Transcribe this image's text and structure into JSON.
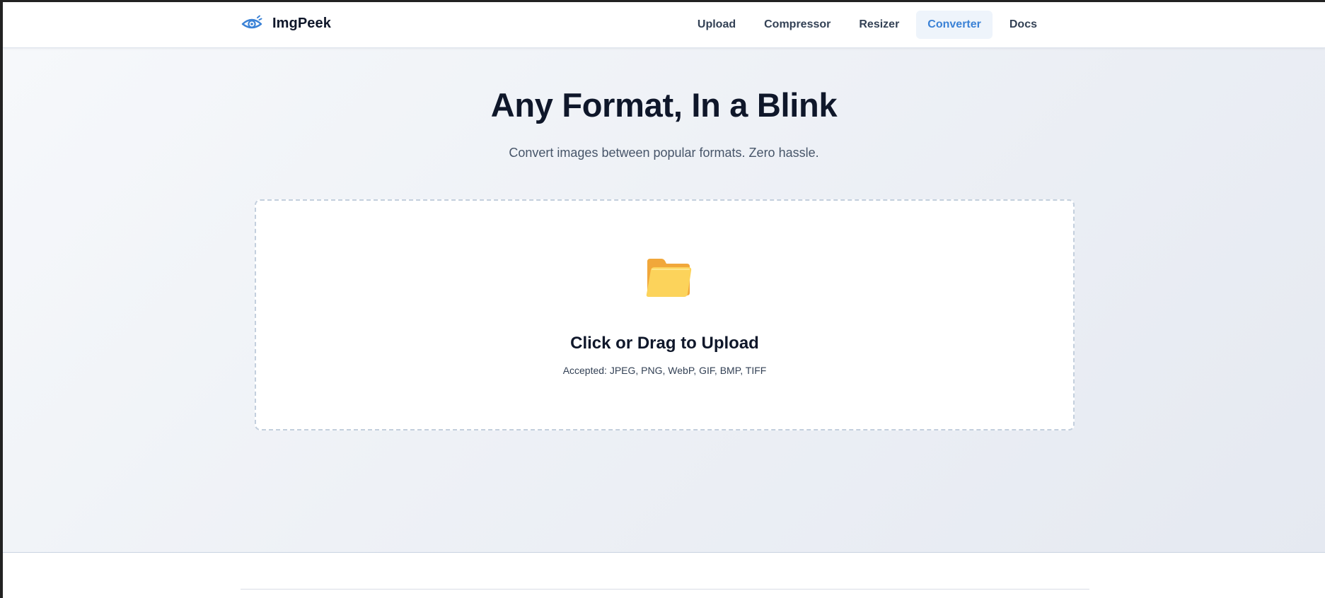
{
  "brand": {
    "name": "ImgPeek",
    "logo_icon": "eye-logo-icon",
    "accent_color": "#3b82d6"
  },
  "nav": {
    "items": [
      {
        "label": "Upload",
        "active": false
      },
      {
        "label": "Compressor",
        "active": false
      },
      {
        "label": "Resizer",
        "active": false
      },
      {
        "label": "Converter",
        "active": true
      },
      {
        "label": "Docs",
        "active": false
      }
    ],
    "active_bg_color": "#eef4fb",
    "active_text_color": "#3b82d6"
  },
  "hero": {
    "title": "Any Format, In a Blink",
    "subtitle": "Convert images between popular formats. Zero hassle."
  },
  "dropzone": {
    "icon": "folder-icon",
    "title": "Click or Drag to Upload",
    "formats": "Accepted: JPEG, PNG, WebP, GIF, BMP, TIFF",
    "border_color": "#c3cfdd"
  }
}
